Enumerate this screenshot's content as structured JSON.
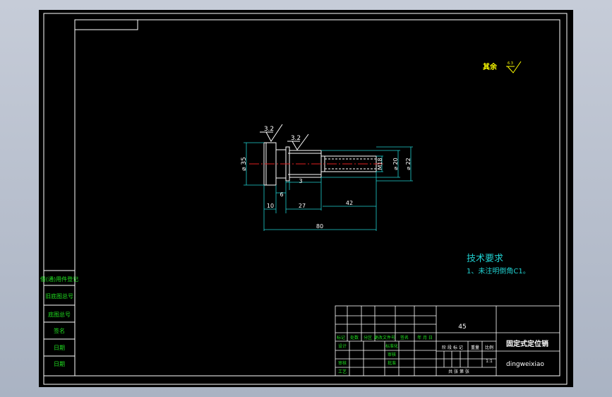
{
  "drawing": {
    "tech_title": "技术要求",
    "tech_note": "1、未注明倒角C1。",
    "other_roughness_label": "其余",
    "other_roughness_value": "6.3",
    "roughness_1": "3.2",
    "roughness_2": "3.2",
    "dim_diameter_large": "⌀ 35",
    "dim_diameter_mid": "⌀ 20",
    "dim_diameter_small": "⌀ 22",
    "dim_thread": "M18",
    "dim_6": "6",
    "dim_3": "3",
    "dim_10": "10",
    "dim_27": "27",
    "dim_42": "42",
    "dim_80": "80",
    "side_labels": [
      "借(通)用件登记",
      "旧底图总号",
      "底图总号",
      "签名",
      "日期",
      "日期"
    ],
    "title_block": {
      "material": "45",
      "part_name": "固定式定位销",
      "drawing_number": "dingweixiao",
      "scale": "1:1",
      "header_cells": [
        "标记",
        "处数",
        "分区",
        "更改文件号",
        "签名",
        "年 月 日"
      ],
      "role_left": [
        "设计",
        "审核",
        "工艺"
      ],
      "role_mid": [
        "标准化",
        "审核",
        "批准"
      ],
      "stage_labels": [
        "阶 段 标 记",
        "重量",
        "比例"
      ],
      "sheet_info": "共  张 第  张"
    }
  }
}
